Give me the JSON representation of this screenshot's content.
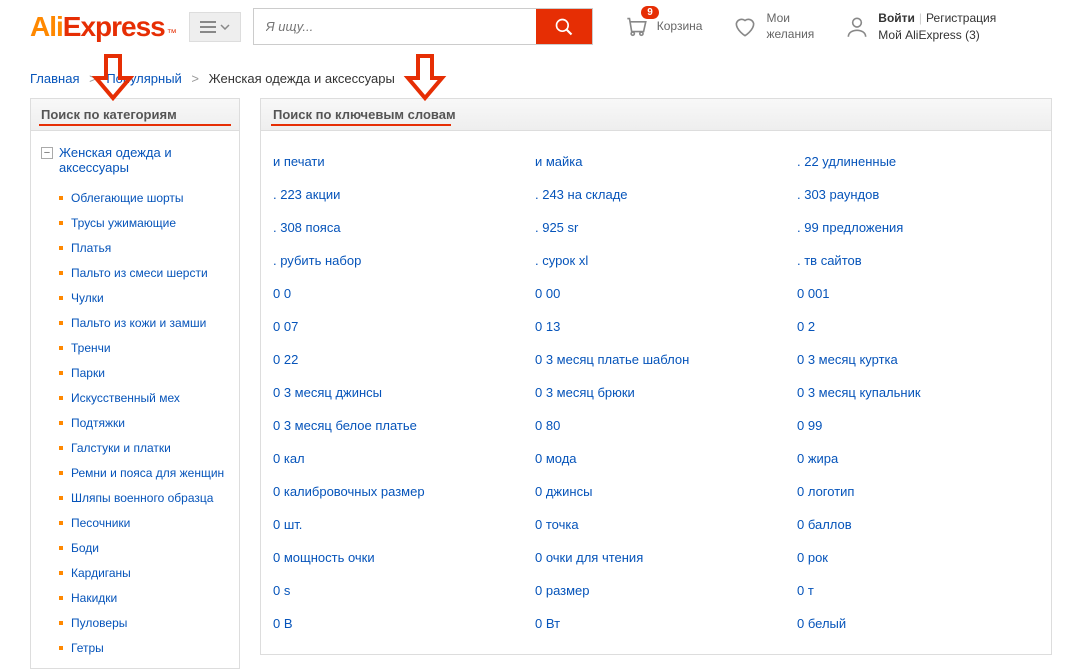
{
  "header": {
    "logo_ali": "Ali",
    "logo_express": "Express",
    "search_placeholder": "Я ищу...",
    "cart_count": "9",
    "cart_label": "Корзина",
    "wishlist_line1": "Мои",
    "wishlist_line2": "желания",
    "login_label": "Войти",
    "register_label": "Регистрация",
    "my_ali_label": "Мой AliExpress (3)"
  },
  "breadcrumb": {
    "home": "Главная",
    "popular": "Популярный",
    "current": "Женская одежда и аксессуары"
  },
  "sidebar": {
    "title": "Поиск по категориям",
    "root_category": "Женская одежда и аксессуары",
    "categories": [
      "Облегающие шорты",
      "Трусы ужимающие",
      "Платья",
      "Пальто из смеси шерсти",
      "Чулки",
      "Пальто из кожи и замши",
      "Тренчи",
      "Парки",
      "Искусственный мех",
      "Подтяжки",
      "Галстуки и платки",
      "Ремни и пояса для женщин",
      "Шляпы военного образца",
      "Песочники",
      "Боди",
      "Кардиганы",
      "Накидки",
      "Пуловеры",
      "Гетры"
    ]
  },
  "content": {
    "title": "Поиск по ключевым словам",
    "keywords": [
      "и печати",
      "и майка",
      ". 22 удлиненные",
      ". 223 акции",
      ". 243 на складе",
      ". 303 раундов",
      ". 308 пояса",
      ". 925 sr",
      ". 99 предложения",
      ". рубить набор",
      ". сурок xl",
      ". тв сайтов",
      "0 0",
      "0 00",
      "0 001",
      "0 07",
      "0 13",
      "0 2",
      "0 22",
      "0 3 месяц платье шаблон",
      "0 3 месяц куртка",
      "0 3 месяц джинсы",
      "0 3 месяц брюки",
      "0 3 месяц купальник",
      "0 3 месяц белое платье",
      "0 80",
      "0 99",
      "0 кал",
      "0 мода",
      "0 жира",
      "0 калибровочных размер",
      "0 джинсы",
      "0 логотип",
      "0 шт.",
      "0 точка",
      "0 баллов",
      "0 мощность очки",
      "0 очки для чтения",
      "0 рок",
      "0 s",
      "0 размер",
      "0 т",
      "0 В",
      "0 Вт",
      "0 белый"
    ]
  }
}
